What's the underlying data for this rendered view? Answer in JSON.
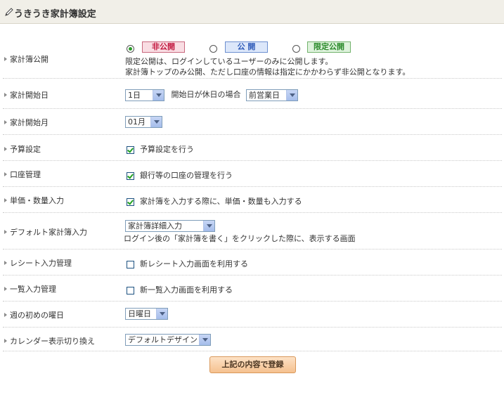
{
  "header": {
    "title": "うきうき家計簿設定",
    "icon": "pencil-icon"
  },
  "rows": {
    "publish": {
      "label": "家計簿公開",
      "options": [
        "非公開",
        "公 開",
        "限定公開"
      ],
      "selected": "非公開",
      "desc1": "限定公開は、ログインしているユーザーのみに公開します。",
      "desc2": "家計簿トップのみ公開、ただし口座の情報は指定にかかわらず非公開となります。"
    },
    "start_day": {
      "label": "家計開始日",
      "value": "1日",
      "holiday_label": "開始日が休日の場合",
      "holiday_value": "前営業日"
    },
    "start_month": {
      "label": "家計開始月",
      "value": "01月"
    },
    "budget": {
      "label": "予算設定",
      "checkbox_label": "予算設定を行う",
      "checked": true
    },
    "account": {
      "label": "口座管理",
      "checkbox_label": "銀行等の口座の管理を行う",
      "checked": true
    },
    "unit_price": {
      "label": "単価・数量入力",
      "checkbox_label": "家計簿を入力する際に、単価・数量も入力する",
      "checked": true
    },
    "default_input": {
      "label": "デフォルト家計簿入力",
      "value": "家計簿詳細入力",
      "desc": "ログイン後の「家計簿を書く」をクリックした際に、表示する画面"
    },
    "receipt": {
      "label": "レシート入力管理",
      "checkbox_label": "新レシート入力画面を利用する",
      "checked": false
    },
    "list_input": {
      "label": "一覧入力管理",
      "checkbox_label": "新一覧入力画面を利用する",
      "checked": false
    },
    "week_start": {
      "label": "週の初めの曜日",
      "value": "日曜日"
    },
    "calendar": {
      "label": "カレンダー表示切り換え",
      "value": "デフォルトデザイン"
    }
  },
  "submit_label": "上記の内容で登録",
  "colors": {
    "private": "#c2163e",
    "public": "#2c59b8",
    "limited": "#2a8a2a",
    "check": "#21a121"
  }
}
